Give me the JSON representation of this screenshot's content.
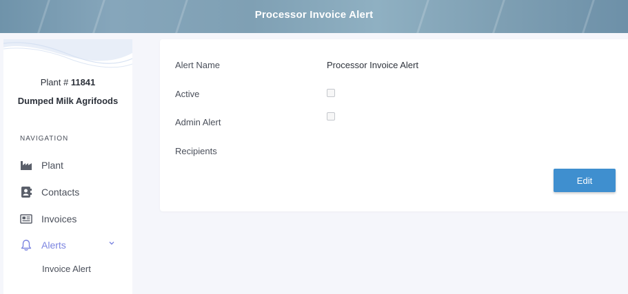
{
  "header": {
    "title": "Processor Invoice Alert"
  },
  "sidebar": {
    "plant_prefix": "Plant # ",
    "plant_number": "11841",
    "plant_name": "Dumped Milk Agrifoods",
    "nav_heading": "NAVIGATION",
    "items": [
      {
        "label": "Plant",
        "icon": "factory-icon"
      },
      {
        "label": "Contacts",
        "icon": "contact-book-icon"
      },
      {
        "label": "Invoices",
        "icon": "newspaper-icon"
      },
      {
        "label": "Alerts",
        "icon": "bell-icon"
      }
    ],
    "sub_item": "Invoice Alert",
    "active_color": "#7b84e0"
  },
  "form": {
    "alert_name_label": "Alert Name",
    "alert_name_value": "Processor Invoice Alert",
    "active_label": "Active",
    "active_checked": false,
    "admin_alert_label": "Admin Alert",
    "admin_alert_checked": false,
    "recipients_label": "Recipients",
    "edit_label": "Edit"
  },
  "colors": {
    "accent_button": "#3f8fcf",
    "page_background": "#f5f6fb"
  }
}
